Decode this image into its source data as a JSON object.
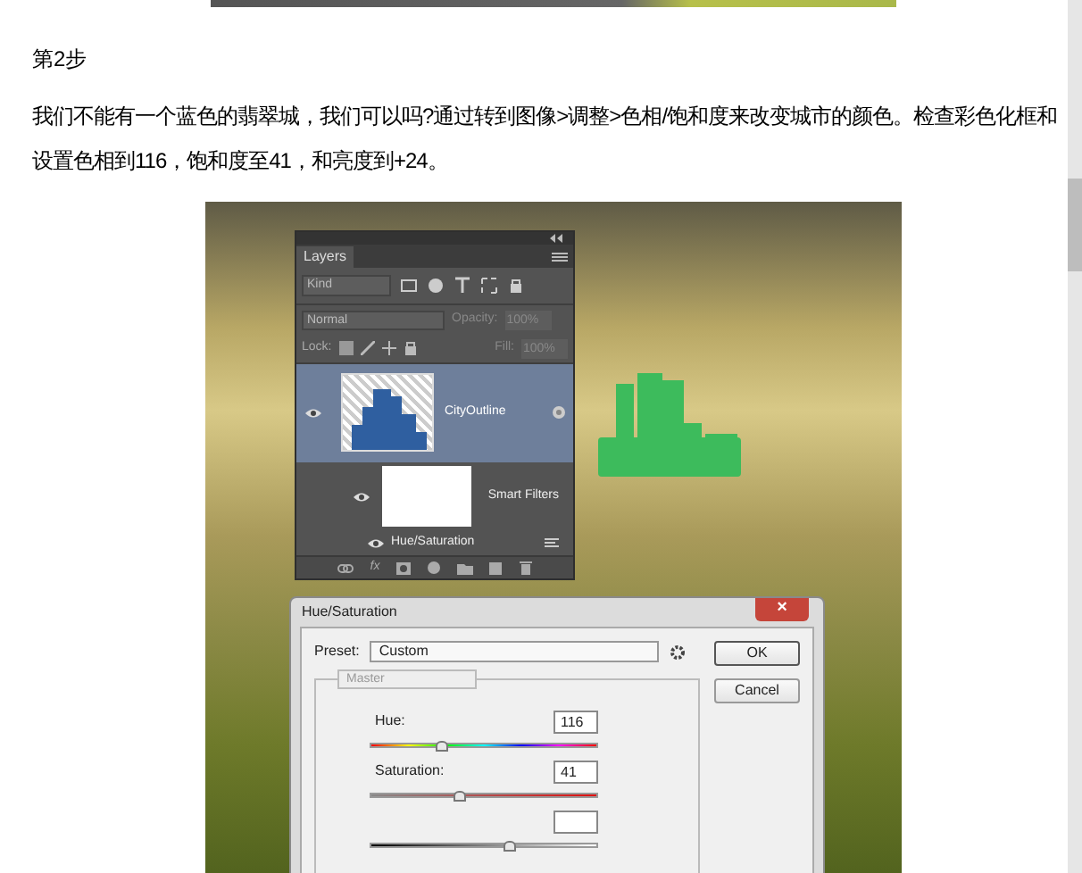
{
  "step_title": "第2步",
  "paragraph": "我们不能有一个蓝色的翡翠城，我们可以吗?通过转到图像>调整>色相/饱和度来改变城市的颜色。检查彩色化框和设置色相到116，饱和度至41，和亮度到+24。",
  "layers_panel": {
    "tab": "Layers",
    "filter": "Kind",
    "blend_mode": "Normal",
    "opacity_label": "Opacity:",
    "opacity": "100%",
    "lock_label": "Lock:",
    "fill_label": "Fill:",
    "fill": "100%",
    "fx": "fx",
    "layers": [
      {
        "kind": "layer",
        "name": "CityOutline",
        "selected": true
      },
      {
        "kind": "smart_filters",
        "name": "Smart Filters",
        "selected": false
      },
      {
        "kind": "filter",
        "name": "Hue/Saturation",
        "selected": false
      }
    ]
  },
  "dialog": {
    "title": "Hue/Saturation",
    "close": "×",
    "preset_label": "Preset:",
    "preset": "Custom",
    "channel": {
      "value": "Master",
      "disabled": true
    },
    "buttons": [
      "OK",
      "Cancel"
    ],
    "sliders": [
      {
        "kind": "hue",
        "label": "Hue:",
        "value": "116",
        "level": 0.32
      },
      {
        "kind": "saturation",
        "label": "Saturation:",
        "value": "41",
        "level": 0.4
      },
      {
        "kind": "lightness",
        "level": 0.62
      }
    ]
  }
}
